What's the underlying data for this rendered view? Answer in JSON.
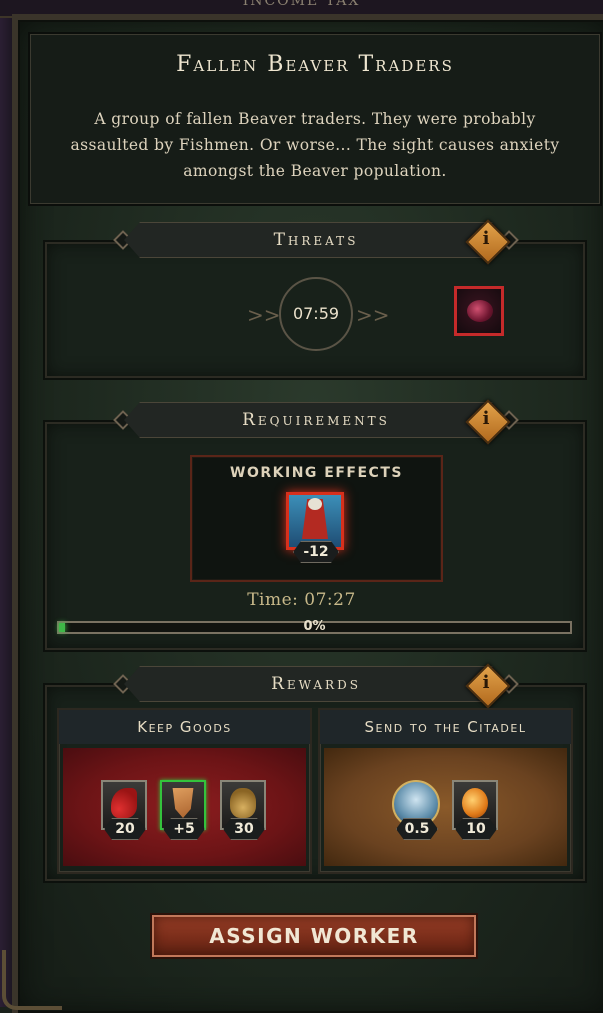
{
  "window": {
    "top_label": "INCOME TAX"
  },
  "event": {
    "title": "Fallen Beaver Traders",
    "description": "A group of fallen Beaver traders. They were probably assaulted by Fishmen. Or worse... The sight causes anxiety amongst the Beaver population."
  },
  "threats": {
    "header": "Threats",
    "info_icon": "info-diamond-icon",
    "timer": "07:59",
    "threat_icon": "corrupted-blob-icon"
  },
  "requirements": {
    "header": "Requirements",
    "info_icon": "info-diamond-icon",
    "box_title": "WORKING EFFECTS",
    "effect": {
      "icon": "skeleton-banner-icon",
      "value": "-12"
    },
    "time_text": "Time: 07:27",
    "progress": {
      "percent_label": "0%",
      "fraction": 0.0
    }
  },
  "rewards": {
    "header": "Rewards",
    "info_icon": "info-diamond-icon",
    "keep": {
      "title": "Keep Goods",
      "items": [
        {
          "icon": "red-fabric-icon",
          "amount": "20",
          "highlight": false
        },
        {
          "icon": "leather-icon",
          "amount": "+5",
          "highlight": true
        },
        {
          "icon": "grain-sack-icon",
          "amount": "30",
          "highlight": false
        }
      ]
    },
    "send": {
      "title": "Send to the Citadel",
      "items": [
        {
          "icon": "crown-reputation-icon",
          "amount": "0.5"
        },
        {
          "icon": "amber-icon",
          "amount": "10"
        }
      ]
    }
  },
  "actions": {
    "assign_label": "ASSIGN WORKER"
  },
  "colors": {
    "accent_red": "#c52a2a",
    "progress_green": "#3fb848",
    "info_orange": "#d8903a",
    "highlight_green": "#34c33c"
  }
}
